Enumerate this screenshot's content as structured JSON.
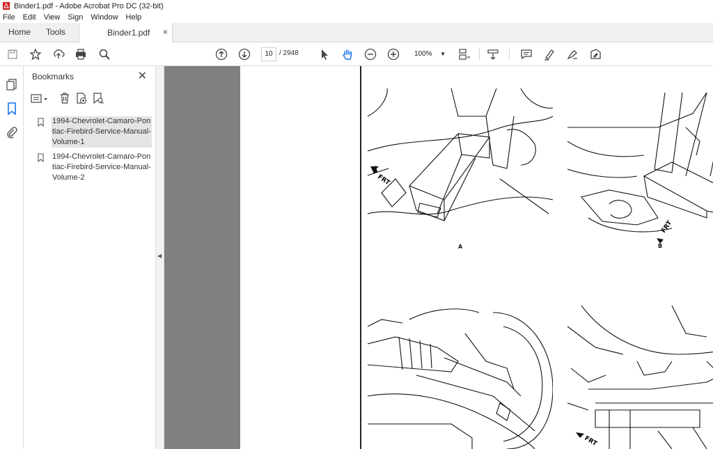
{
  "window": {
    "title": "Binder1.pdf - Adobe Acrobat Pro DC (32-bit)"
  },
  "menu": [
    "File",
    "Edit",
    "View",
    "Sign",
    "Window",
    "Help"
  ],
  "tabs": {
    "home": "Home",
    "tools": "Tools",
    "document": "Binder1.pdf",
    "close_glyph": "×"
  },
  "toolbar": {
    "current_page": "10",
    "page_count": "/ 2948",
    "zoom": "100%",
    "icons": [
      "save-icon",
      "bookmark-star-icon",
      "upload-icon",
      "print-icon",
      "search-icon",
      "page-up-icon",
      "page-down-icon",
      "select-arrow-icon",
      "hand-icon",
      "zoom-out-icon",
      "zoom-in-icon",
      "page-layout-icon",
      "scroll-icon",
      "comment-icon",
      "highlight-icon",
      "sign-icon",
      "fill-sign-icon"
    ]
  },
  "bookmarks": {
    "title": "Bookmarks",
    "close_glyph": "✕",
    "items": [
      {
        "label": "1994-Chevrolet-Camaro-Pontiac-Firebird-Service-Manual-Volume-1",
        "selected": true
      },
      {
        "label": "1994-Chevrolet-Camaro-Pontiac-Firebird-Service-Manual-Volume-2",
        "selected": false
      }
    ]
  },
  "document": {
    "figure_labels": [
      "A",
      "B"
    ],
    "arrow_label": "FRT"
  },
  "colors": {
    "accent": "#1473e6",
    "doc_background": "#808080",
    "pdf_red": "#d4201f"
  }
}
